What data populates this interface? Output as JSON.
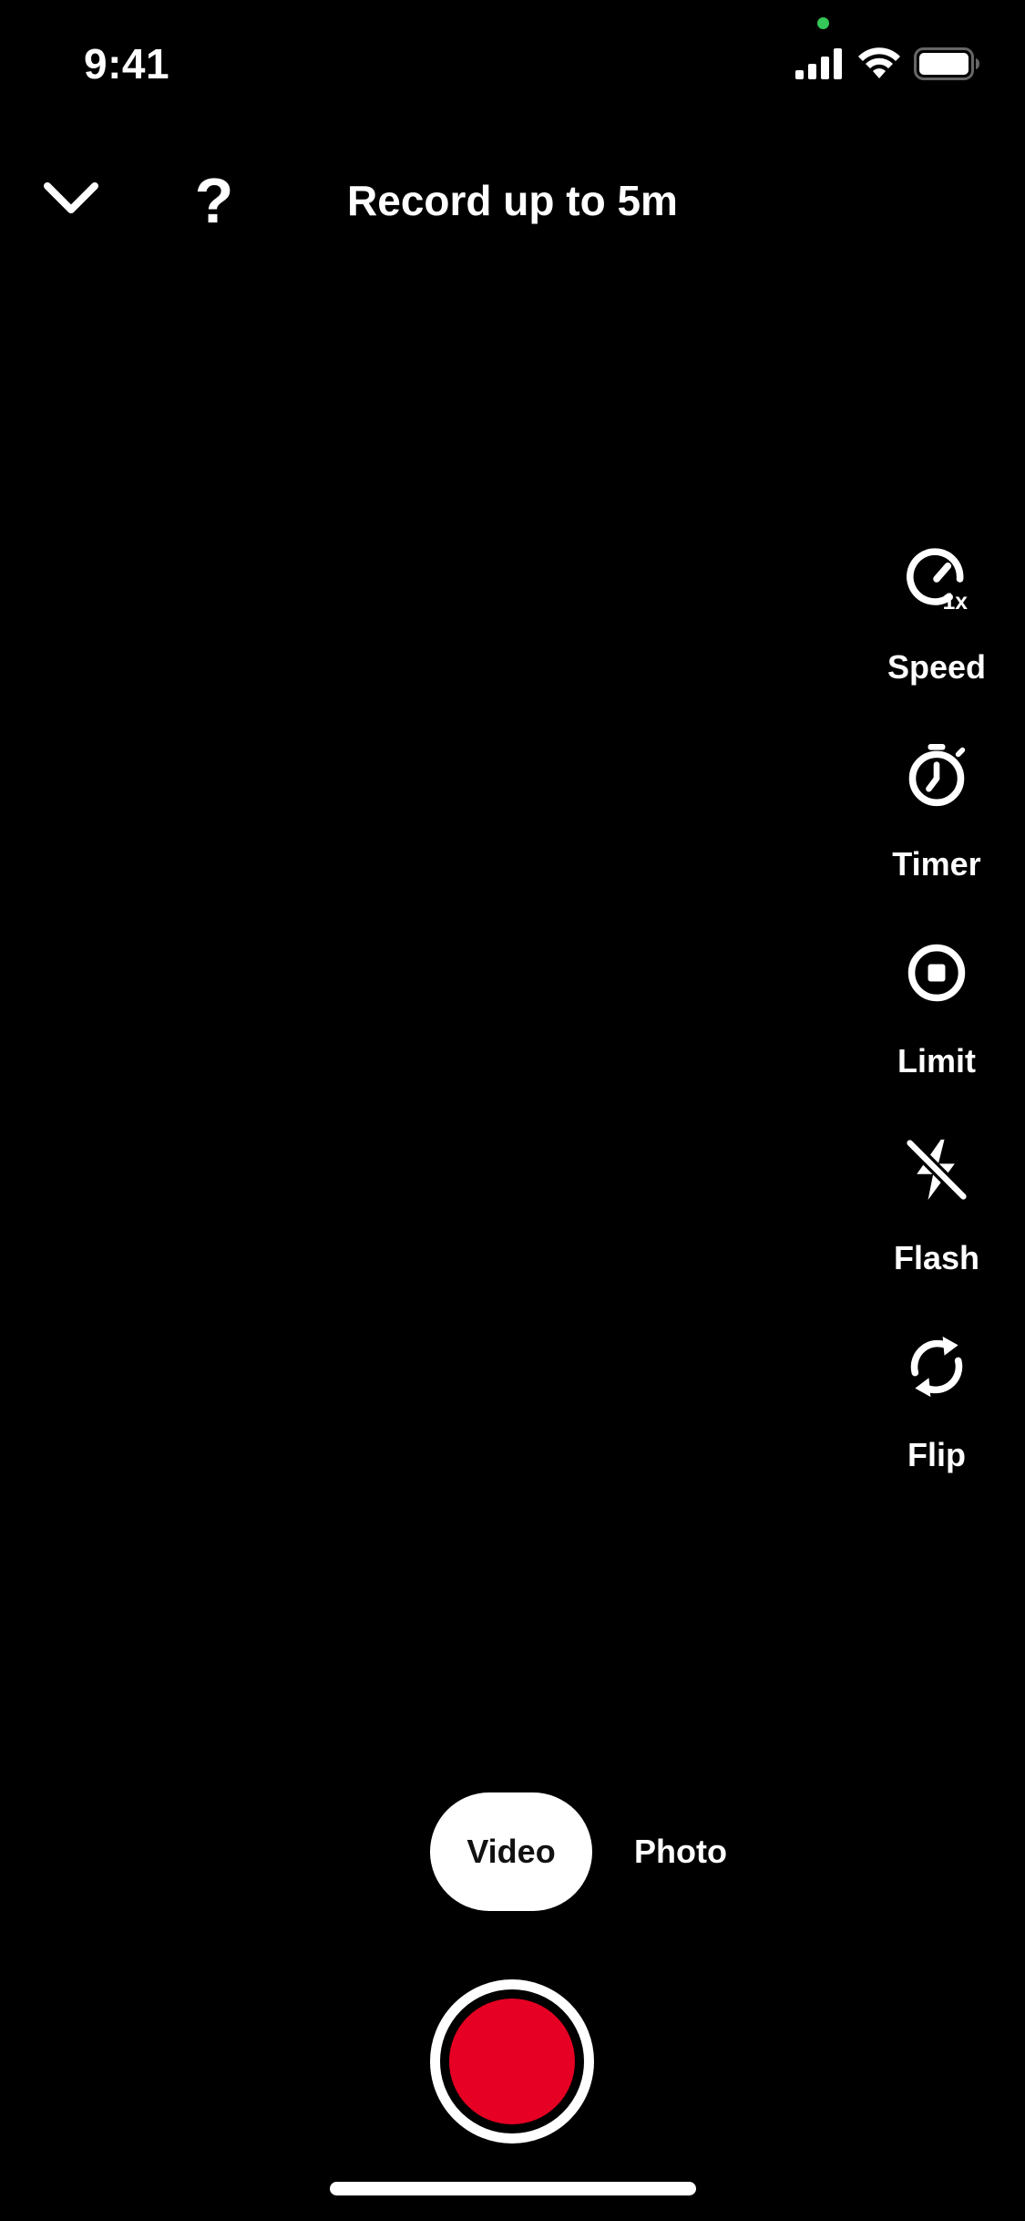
{
  "status_bar": {
    "time": "9:41",
    "privacy_indicator_color": "#34C759",
    "icons": [
      "cellular-signal-icon",
      "wifi-icon",
      "battery-icon"
    ]
  },
  "header": {
    "collapse_icon": "chevron-down-icon",
    "help_label": "?",
    "title": "Record up to 5m"
  },
  "tools": [
    {
      "icon": "speed-icon",
      "badge": "1x",
      "label": "Speed"
    },
    {
      "icon": "timer-icon",
      "label": "Timer"
    },
    {
      "icon": "limit-icon",
      "label": "Limit"
    },
    {
      "icon": "flash-off-icon",
      "label": "Flash"
    },
    {
      "icon": "flip-camera-icon",
      "label": "Flip"
    }
  ],
  "capture_mode": {
    "options": [
      "Video",
      "Photo"
    ],
    "selected": "Video"
  },
  "shutter": {
    "color": "#E60023"
  }
}
